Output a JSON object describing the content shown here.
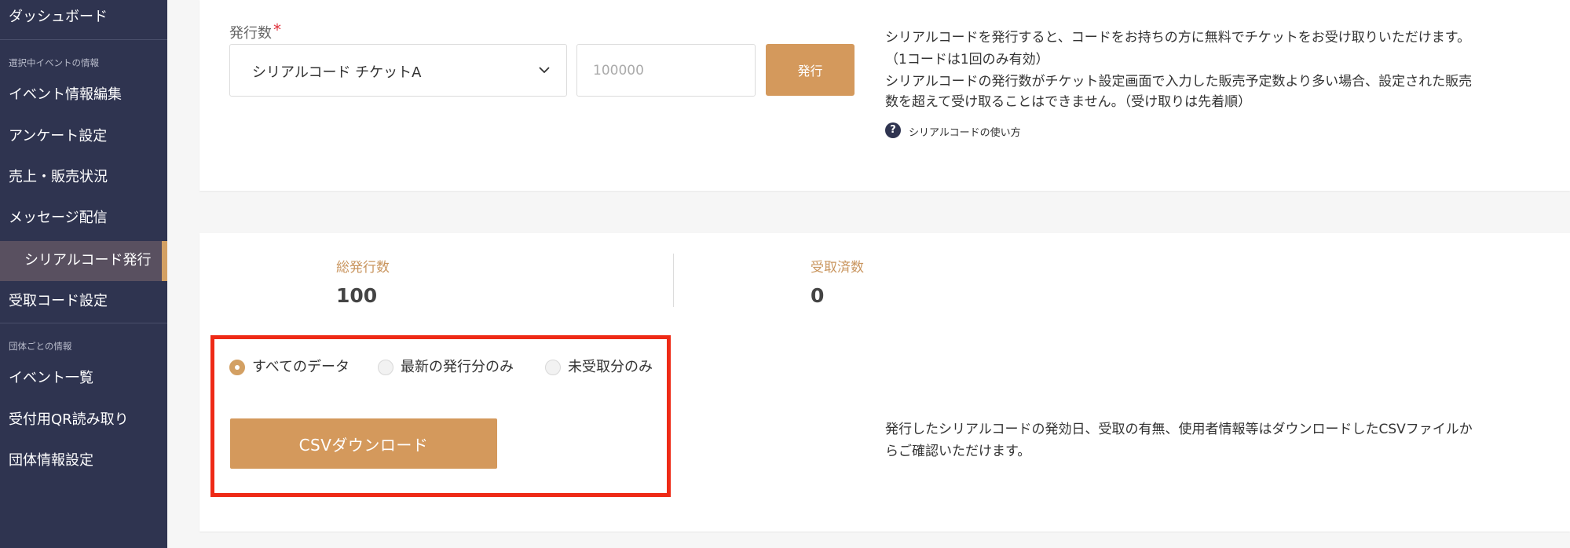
{
  "sidebar": {
    "dashboard": "ダッシュボード",
    "section_event": "選択中イベントの情報",
    "items_event": [
      "イベント情報編集",
      "アンケート設定",
      "売上・販売状況",
      "メッセージ配信",
      "シリアルコード発行",
      "受取コード設定"
    ],
    "section_group": "団体ごとの情報",
    "items_group": [
      "イベント一覧",
      "受付用QR読み取り",
      "団体情報設定"
    ],
    "active_index": 4
  },
  "issue_form": {
    "label": "発行数",
    "required_mark": "*",
    "ticket_select_value": "シリアルコード チケットA",
    "quantity_placeholder": "100000",
    "issue_button": "発行"
  },
  "description": {
    "lines": [
      "シリアルコードを発行すると、コードをお持ちの方に無料でチケットをお受け取りいただけます。",
      "（1コードは1回のみ有効）",
      "シリアルコードの発行数がチケット設定画面で入力した販売予定数より多い場合、設定された販売",
      "数を超えて受け取ることはできません。（受け取りは先着順）"
    ],
    "help_link": "シリアルコードの使い方",
    "help_icon_glyph": "?"
  },
  "stats": {
    "total_label": "総発行数",
    "total_value": "100",
    "received_label": "受取済数",
    "received_value": "0"
  },
  "filters": {
    "options": [
      "すべてのデータ",
      "最新の発行分のみ",
      "未受取分のみ"
    ],
    "selected_index": 0
  },
  "csv": {
    "button_label": "CSVダウンロード",
    "description_lines": [
      "発行したシリアルコードの発効日、受取の有無、使用者情報等はダウンロードしたCSVファイルか",
      "らご確認いただけます。"
    ]
  },
  "colors": {
    "sidebar_bg": "#2f3450",
    "accent": "#d4995c",
    "highlight": "#ee2a16",
    "required": "#e0323c"
  }
}
